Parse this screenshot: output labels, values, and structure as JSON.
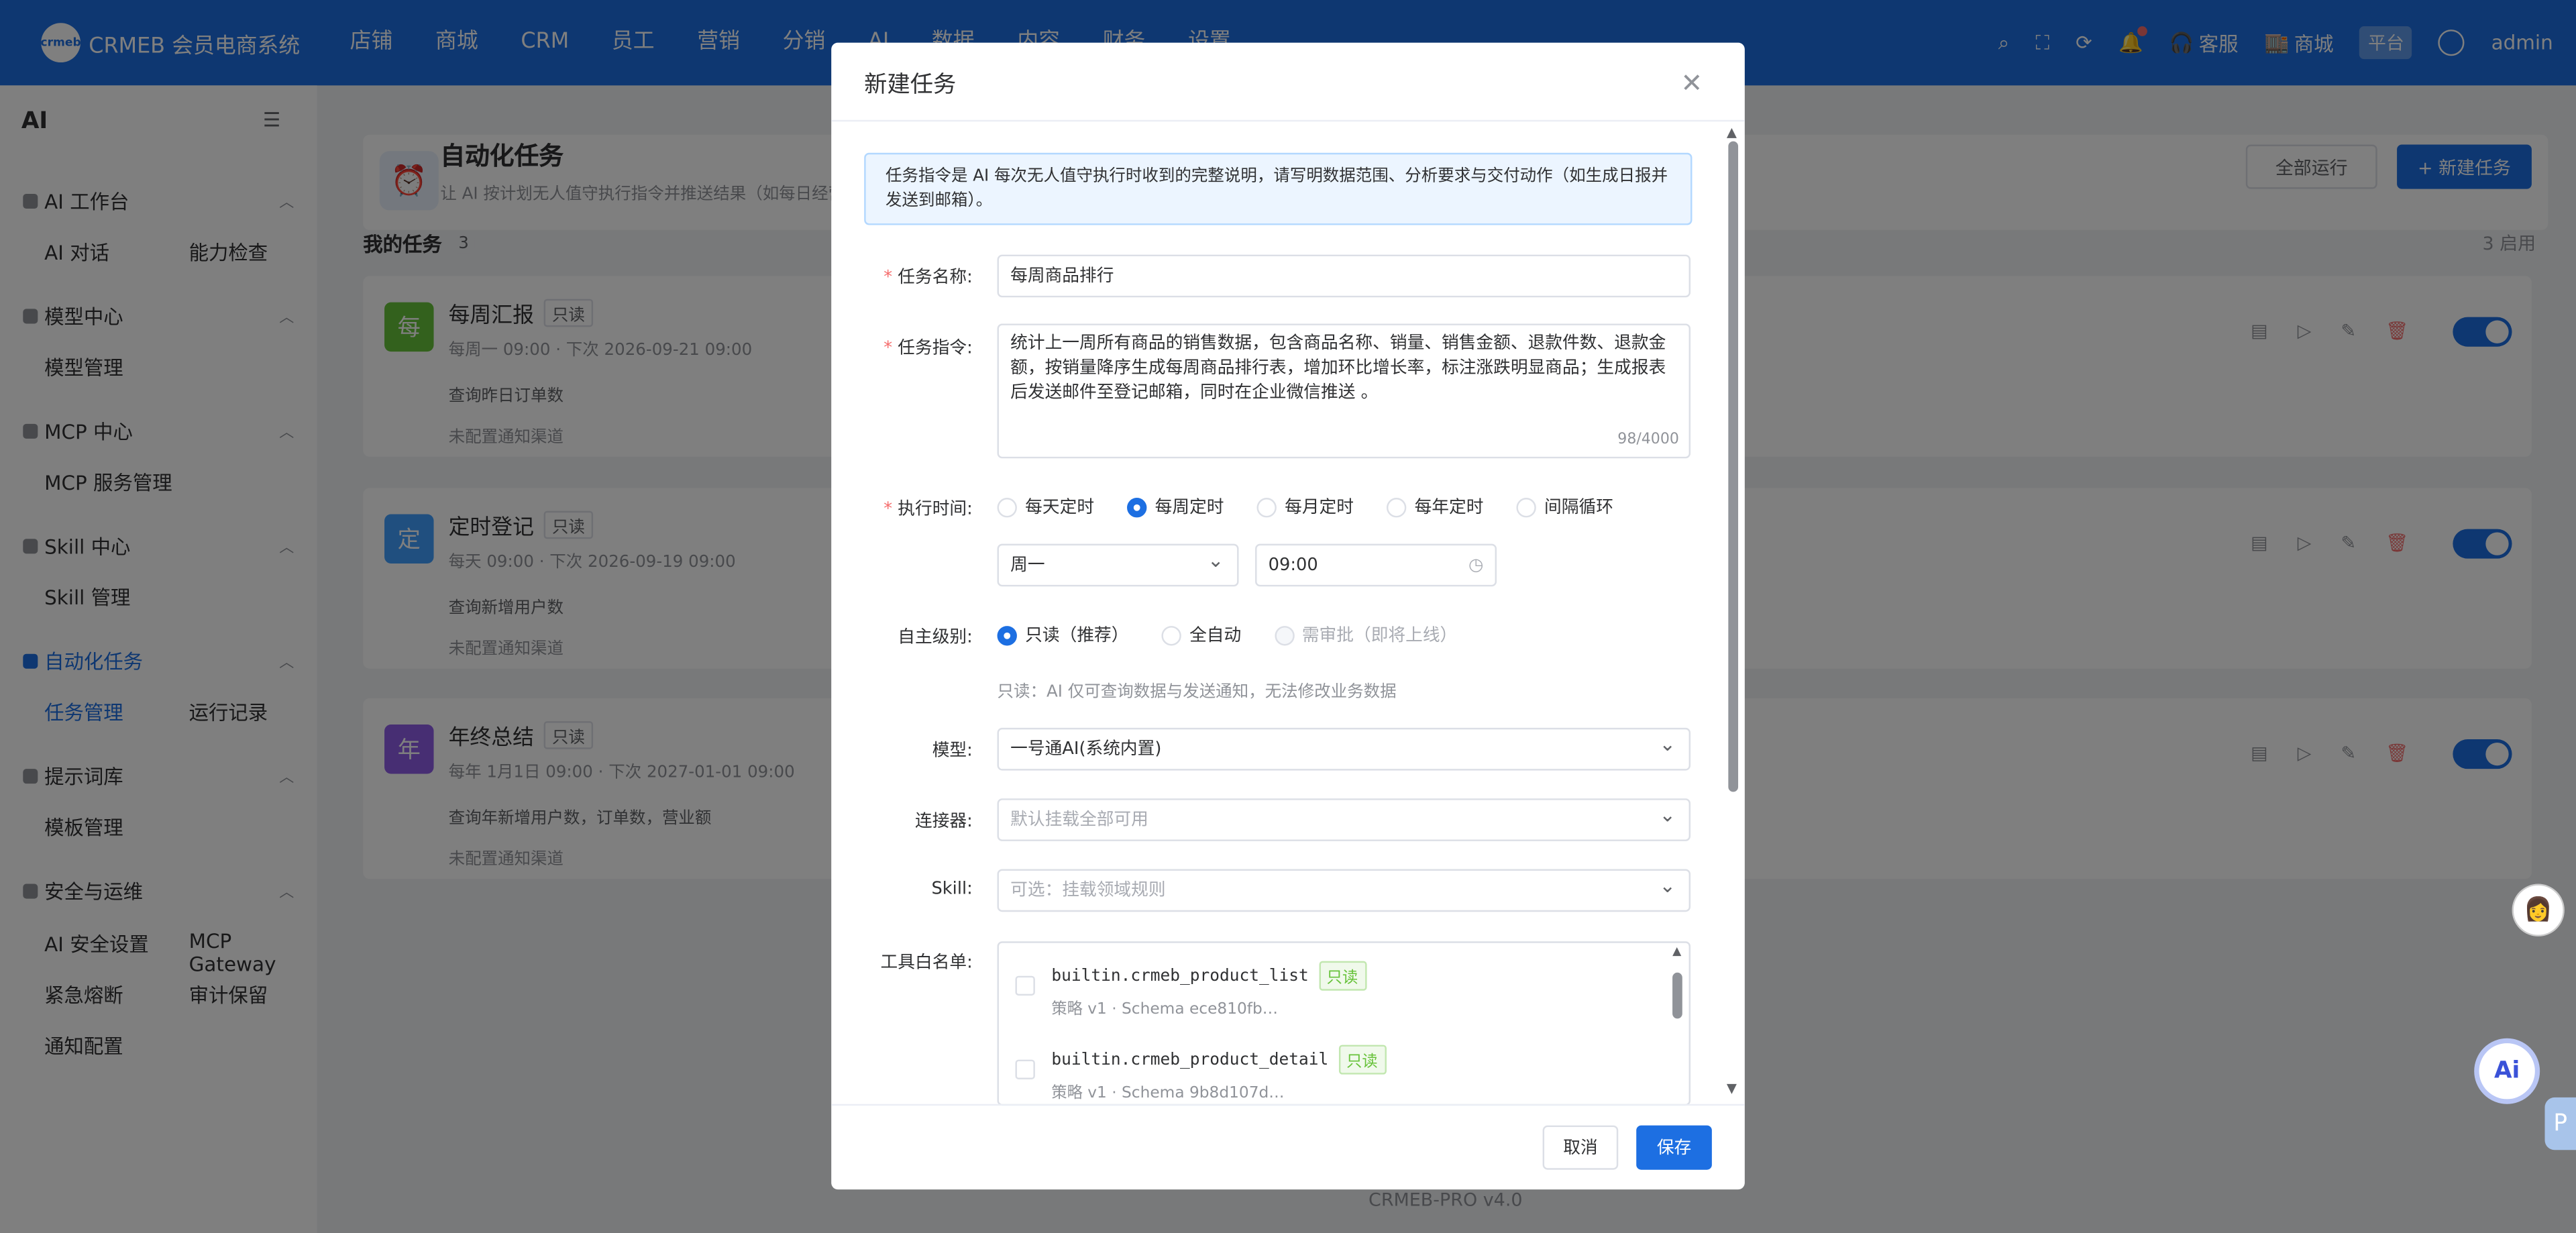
{
  "app": {
    "logo_mark": "crmeb",
    "brand": "CRMEB 会员电商系统"
  },
  "nav": [
    "店铺",
    "商城",
    "CRM",
    "员工",
    "营销",
    "分销",
    "AI",
    "数据",
    "内容",
    "财务",
    "设置"
  ],
  "topright": {
    "service": "客服",
    "mall": "商城",
    "platform": "平台",
    "user": "admin"
  },
  "sidebar": {
    "title": "AI",
    "groups": [
      {
        "label": "AI 工作台",
        "items": [
          "AI 对话",
          "能力检查"
        ]
      },
      {
        "label": "模型中心",
        "items": [
          "模型管理"
        ]
      },
      {
        "label": "MCP 中心",
        "items": [
          "MCP 服务管理"
        ]
      },
      {
        "label": "Skill 中心",
        "items": [
          "Skill 管理"
        ]
      },
      {
        "label": "自动化任务",
        "items": [
          "任务管理",
          "运行记录"
        ]
      },
      {
        "label": "提示词库",
        "items": [
          "模板管理"
        ]
      },
      {
        "label": "安全与运维",
        "items": [
          "AI 安全设置",
          "MCP Gateway",
          "紧急熔断",
          "审计保留",
          "通知配置"
        ]
      }
    ]
  },
  "page": {
    "title": "自动化任务",
    "subtitle": "让 AI 按计划无人值守执行指令并推送结果（如每日经营",
    "run_all": "全部运行",
    "new_task": "+ 新建任务",
    "my_tasks": "我的任务",
    "task_count": "3",
    "enabled": "3 启用",
    "tasks": [
      {
        "icon": "每",
        "name": "每周汇报",
        "tag": "只读",
        "color": "#67c23a",
        "schedule": "每周一 09:00 · 下次 2026-09-21 09:00",
        "command": "查询昨日订单数",
        "notify": "未配置通知渠道"
      },
      {
        "icon": "定",
        "name": "定时登记",
        "tag": "只读",
        "color": "#409eff",
        "schedule": "每天 09:00 · 下次 2026-09-19 09:00",
        "command": "查询新增用户数",
        "notify": "未配置通知渠道"
      },
      {
        "icon": "年",
        "name": "年终总结",
        "tag": "只读",
        "color": "#8e5ce6",
        "schedule": "每年 1月1日 09:00 · 下次 2027-01-01 09:00",
        "command": "查询年新增用户数，订单数，营业额",
        "notify": "未配置通知渠道"
      }
    ],
    "version": "CRMEB-PRO v4.0"
  },
  "modal": {
    "title": "新建任务",
    "tip": "任务指令是 AI 每次无人值守执行时收到的完整说明，请写明数据范围、分析要求与交付动作（如生成日报并发送到邮箱）。",
    "name_label": "任务名称:",
    "name_value": "每周商品排行",
    "command_label": "任务指令:",
    "command_value": "统计上一周所有商品的销售数据，包含商品名称、销量、销售金额、退款件数、退款金额，按销量降序生成每周商品排行表，增加环比增长率，标注涨跌明显商品；生成报表后发送邮件至登记邮箱，同时在企业微信推送 。",
    "command_count": "98/4000",
    "time_label": "执行时间:",
    "time_options": [
      "每天定时",
      "每周定时",
      "每月定时",
      "每年定时",
      "间隔循环"
    ],
    "time_selected": 1,
    "weekday": "周一",
    "time_value": "09:00",
    "level_label": "自主级别:",
    "level_options": [
      "只读（推荐）",
      "全自动",
      "需审批（即将上线）"
    ],
    "level_hint": "只读：AI 仅可查询数据与发送通知，无法修改业务数据",
    "model_label": "模型:",
    "model_value": "一号通AI(系统内置)",
    "connector_label": "连接器:",
    "connector_placeholder": "默认挂载全部可用",
    "skill_label": "Skill:",
    "skill_placeholder": "可选：挂载领域规则",
    "whitelist_label": "工具白名单:",
    "tools": [
      {
        "name": "builtin.crmeb_product_list",
        "tag": "只读",
        "meta": "策略 v1 · Schema ece810fb…"
      },
      {
        "name": "builtin.crmeb_product_detail",
        "tag": "只读",
        "meta": "策略 v1 · Schema 9b8d107d…"
      }
    ],
    "cancel": "取消",
    "save": "保存"
  }
}
